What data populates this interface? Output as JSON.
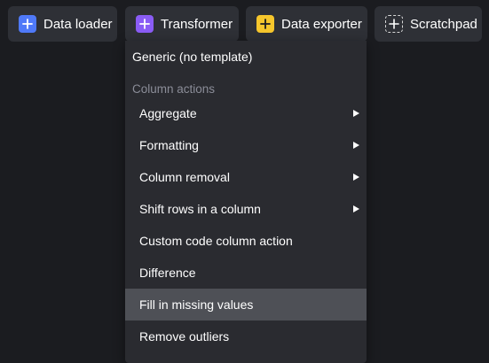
{
  "toolbar": {
    "buttons": [
      {
        "label": "Data loader",
        "icon": "plus-icon",
        "color": "#4f79f8"
      },
      {
        "label": "Transformer",
        "icon": "plus-icon",
        "color": "#8a5cf5"
      },
      {
        "label": "Data exporter",
        "icon": "plus-icon",
        "color": "#f6c62c"
      },
      {
        "label": "Scratchpad",
        "icon": "plus-icon",
        "color": "transparent"
      }
    ]
  },
  "menu": {
    "generic_label": "Generic (no template)",
    "group_heading": "Column actions",
    "items": [
      {
        "label": "Aggregate",
        "has_submenu": true
      },
      {
        "label": "Formatting",
        "has_submenu": true
      },
      {
        "label": "Column removal",
        "has_submenu": true
      },
      {
        "label": "Shift rows in a column",
        "has_submenu": true
      },
      {
        "label": "Custom code column action",
        "has_submenu": false
      },
      {
        "label": "Difference",
        "has_submenu": false
      },
      {
        "label": "Fill in missing values",
        "has_submenu": false,
        "highlighted": true
      },
      {
        "label": "Remove outliers",
        "has_submenu": false
      }
    ]
  },
  "colors": {
    "background": "#1b1c20",
    "button_bg": "#2e3036",
    "menu_bg": "#2a2b30",
    "highlight_bg": "#4e5056",
    "group_heading": "#8b8d98"
  }
}
